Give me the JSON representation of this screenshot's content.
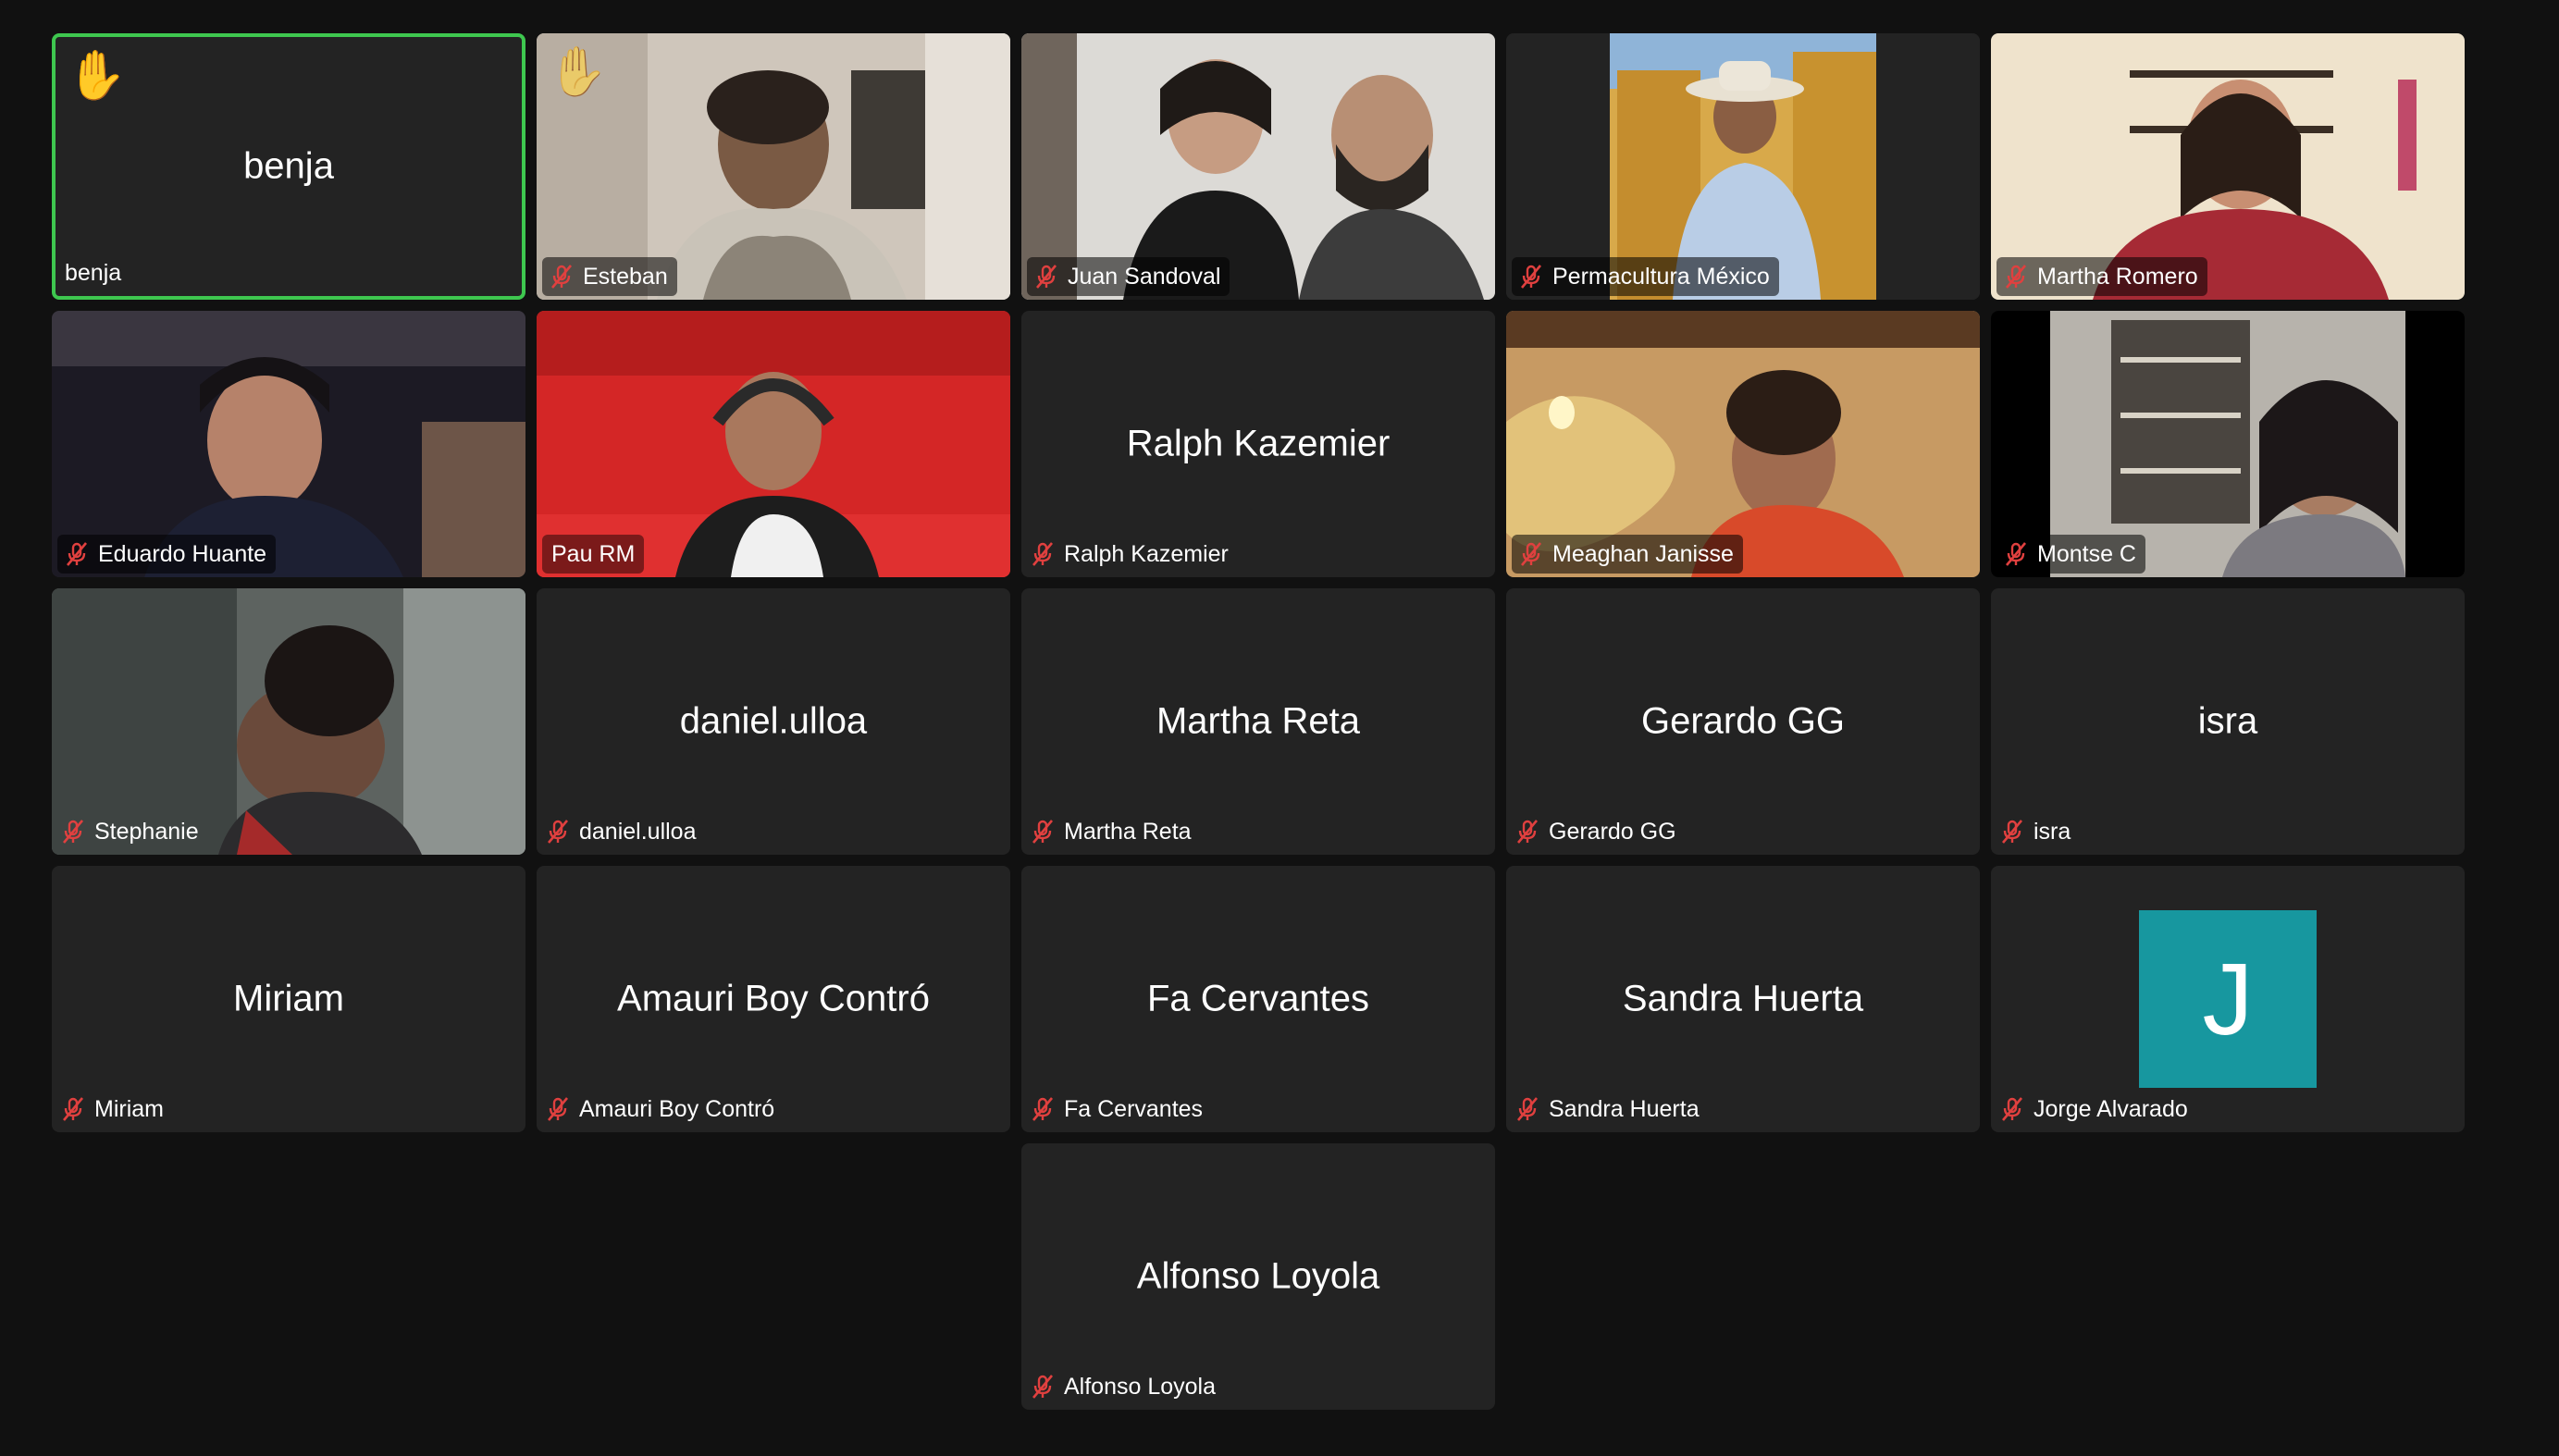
{
  "participants": [
    {
      "name": "benja",
      "big_name": "benja",
      "video": false,
      "hand_raised": true,
      "active": true,
      "muted": false
    },
    {
      "name": "Esteban",
      "video": true,
      "hand_raised": true,
      "muted": true,
      "scene": "room-beige"
    },
    {
      "name": "Juan Sandoval",
      "video": true,
      "muted": true,
      "scene": "two-people-white"
    },
    {
      "name": "Permacultura México",
      "video": true,
      "muted": true,
      "scene": "cowboy-yellow",
      "letterbox": true
    },
    {
      "name": "Martha Romero",
      "video": true,
      "muted": true,
      "scene": "woman-cream"
    },
    {
      "name": "Eduardo Huante",
      "video": true,
      "muted": true,
      "scene": "dark-room"
    },
    {
      "name": "Pau RM",
      "video": true,
      "muted": false,
      "scene": "red-couch"
    },
    {
      "name": "Ralph Kazemier",
      "big_name": "Ralph Kazemier",
      "video": false,
      "muted": true
    },
    {
      "name": "Meaghan Janisse",
      "video": true,
      "muted": true,
      "scene": "mural-warm"
    },
    {
      "name": "Montse C",
      "video": true,
      "muted": true,
      "scene": "bookshelf",
      "letterbox": true
    },
    {
      "name": "Stephanie",
      "video": true,
      "muted": true,
      "scene": "blurry-dark"
    },
    {
      "name": "daniel.ulloa",
      "big_name": "daniel.ulloa",
      "video": false,
      "muted": true
    },
    {
      "name": "Martha Reta",
      "big_name": "Martha Reta",
      "video": false,
      "muted": true
    },
    {
      "name": "Gerardo GG",
      "big_name": "Gerardo GG",
      "video": false,
      "muted": true
    },
    {
      "name": "isra",
      "big_name": "isra",
      "video": false,
      "muted": true
    },
    {
      "name": "Miriam",
      "big_name": "Miriam",
      "video": false,
      "muted": true
    },
    {
      "name": "Amauri Boy Contró",
      "big_name": "Amauri Boy Contró",
      "video": false,
      "muted": true
    },
    {
      "name": "Fa Cervantes",
      "big_name": "Fa Cervantes",
      "video": false,
      "muted": true
    },
    {
      "name": "Sandra Huerta",
      "big_name": "Sandra Huerta",
      "video": false,
      "muted": true
    },
    {
      "name": "Jorge Alvarado",
      "avatar_letter": "J",
      "video": false,
      "muted": true
    },
    {
      "name": "Alfonso Loyola",
      "big_name": "Alfonso Loyola",
      "video": false,
      "muted": true
    }
  ],
  "colors": {
    "background": "#111111",
    "tile": "#232323",
    "active_border": "#3ec74f",
    "muted_icon": "#e0403f",
    "avatar": "#17979f"
  },
  "icons": {
    "muted": "mic-muted-icon",
    "hand": "raised-hand-icon"
  }
}
